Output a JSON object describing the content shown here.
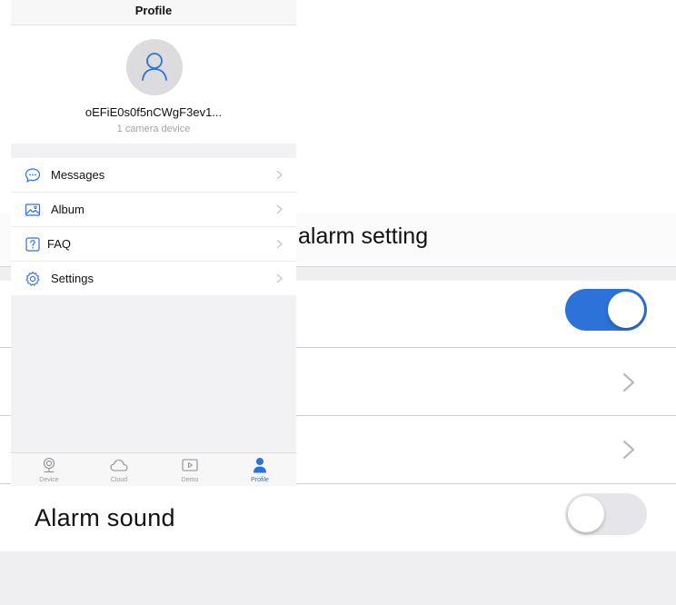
{
  "background_screen": {
    "title": "alarm setting",
    "rows": [
      {
        "label": "",
        "control": "toggle",
        "on": true
      },
      {
        "label": "",
        "control": "chevron"
      },
      {
        "label": "",
        "control": "chevron"
      },
      {
        "label": "Alarm sound",
        "control": "toggle",
        "on": false
      }
    ]
  },
  "profile_screen": {
    "nav_title": "Profile",
    "user": {
      "name": "oEFiE0s0f5nCWgF3ev1...",
      "device_count": "1 camera device"
    },
    "menu": [
      {
        "label": "Messages",
        "icon": "chat-bubble-icon"
      },
      {
        "label": "Album",
        "icon": "image-icon"
      },
      {
        "label": "FAQ",
        "icon": "question-icon"
      },
      {
        "label": "Settings",
        "icon": "gear-icon"
      }
    ],
    "tabs": [
      {
        "label": "Device",
        "icon": "camera-icon",
        "active": false
      },
      {
        "label": "Cloud",
        "icon": "cloud-icon",
        "active": false
      },
      {
        "label": "Demo",
        "icon": "play-icon",
        "active": false
      },
      {
        "label": "Profile",
        "icon": "person-icon",
        "active": true
      }
    ]
  },
  "colors": {
    "accent": "#2d72d9",
    "toggle_off": "#e6e6ea",
    "separator": "#cfcfd3",
    "page_background": "#efeff2"
  }
}
